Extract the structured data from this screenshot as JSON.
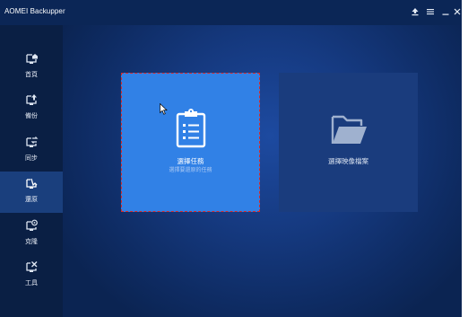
{
  "app": {
    "title": "AOMEI Backupper"
  },
  "titlebar": {
    "buttons": [
      {
        "icon": "upgrade-icon"
      },
      {
        "icon": "menu-icon"
      },
      {
        "icon": "minimize-icon"
      },
      {
        "icon": "close-icon"
      }
    ]
  },
  "sidebar": {
    "items": [
      {
        "label": "首頁",
        "icon": "home-icon",
        "active": false
      },
      {
        "label": "備份",
        "icon": "backup-icon",
        "active": false
      },
      {
        "label": "同步",
        "icon": "sync-icon",
        "active": false
      },
      {
        "label": "還原",
        "icon": "restore-icon",
        "active": true
      },
      {
        "label": "克隆",
        "icon": "clone-icon",
        "active": false
      },
      {
        "label": "工具",
        "icon": "tools-icon",
        "active": false
      }
    ]
  },
  "main": {
    "cards": [
      {
        "title": "選擇任務",
        "subtitle": "選擇要還原的任務",
        "icon": "clipboard-list-icon",
        "selected": true
      },
      {
        "title": "選擇映像檔案",
        "icon": "folder-open-icon",
        "selected": false
      }
    ]
  },
  "colors": {
    "titlebar": "#0b2656",
    "sidebar": "#0a1f44",
    "sidebar_active": "#1a3f7d",
    "card_selected": "#3181e6",
    "card_normal": "#1a3c7d",
    "selection_outline": "#d62b2b"
  }
}
